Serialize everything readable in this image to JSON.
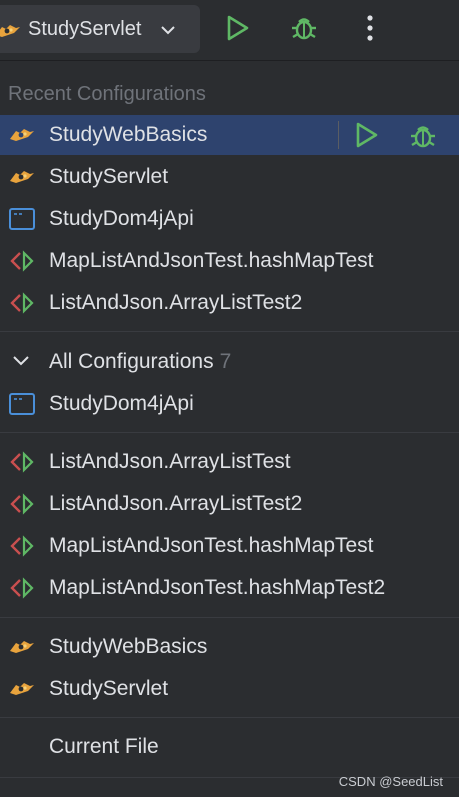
{
  "toolbar": {
    "selected_config": "StudyServlet",
    "icons": {
      "config": "tomcat-icon",
      "dropdown": "chevron-down-icon",
      "run": "run-icon",
      "debug": "debug-icon",
      "more": "more-vertical-icon"
    }
  },
  "recent": {
    "header": "Recent Configurations",
    "items": [
      {
        "label": "StudyWebBasics",
        "icon": "tomcat-icon",
        "selected": true
      },
      {
        "label": "StudyServlet",
        "icon": "tomcat-icon"
      },
      {
        "label": "StudyDom4jApi",
        "icon": "application-icon"
      },
      {
        "label": "MapListAndJsonTest.hashMapTest",
        "icon": "test-icon"
      },
      {
        "label": "ListAndJson.ArrayListTest2",
        "icon": "test-icon"
      }
    ]
  },
  "all": {
    "header": "All Configurations",
    "count": "7",
    "group1": [
      {
        "label": "StudyDom4jApi",
        "icon": "application-icon"
      }
    ],
    "group2": [
      {
        "label": "ListAndJson.ArrayListTest",
        "icon": "test-icon"
      },
      {
        "label": "ListAndJson.ArrayListTest2",
        "icon": "test-icon"
      },
      {
        "label": "MapListAndJsonTest.hashMapTest",
        "icon": "test-icon"
      },
      {
        "label": "MapListAndJsonTest.hashMapTest2",
        "icon": "test-icon"
      }
    ],
    "group3": [
      {
        "label": "StudyWebBasics",
        "icon": "tomcat-icon"
      },
      {
        "label": "StudyServlet",
        "icon": "tomcat-icon"
      }
    ]
  },
  "current_file": {
    "label": "Current File"
  },
  "watermark": "CSDN @SeedList",
  "colors": {
    "background": "#2b2d30",
    "selected_row": "#2e436e",
    "run_green": "#5fb865",
    "muted_text": "#6f737a"
  }
}
